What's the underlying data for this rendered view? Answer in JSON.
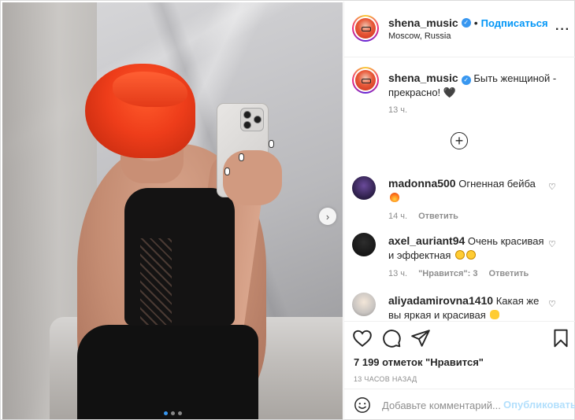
{
  "author": {
    "username": "shena_music",
    "verified_icon": "verified-badge-icon",
    "separator": "•",
    "follow_label": "Подписаться",
    "location": "Moscow, Russia",
    "more_icon": "more-options-icon",
    "more_symbol": "···"
  },
  "photo": {
    "next_icon": "chevron-right-icon",
    "next_symbol": "›",
    "slide_count": 3,
    "active_slide": 1
  },
  "caption": {
    "username": "shena_music",
    "text": "Быть женщиной - прекрасно! 🖤",
    "time": "13 ч."
  },
  "load_more": {
    "icon": "plus-circle-icon",
    "symbol": "+"
  },
  "comments": [
    {
      "username": "madonna500",
      "text": "Огненная бейба",
      "emoji": "fire-emoji",
      "time": "14 ч.",
      "likes_label": "",
      "reply_label": "Ответить"
    },
    {
      "username": "axel_auriant94",
      "text": "Очень красивая и эффектная",
      "emoji": "smile-emoji",
      "time": "13 ч.",
      "likes_label": "\"Нравится\": 3",
      "reply_label": "Ответить"
    },
    {
      "username": "aliyadamirovna1410",
      "text": "Какая же вы яркая и красивая",
      "emoji": "clap-emoji",
      "time": "",
      "likes_label": "",
      "reply_label": ""
    }
  ],
  "comment_like_symbol": "♡",
  "actions": {
    "like_icon": "heart-icon",
    "comment_icon": "comment-icon",
    "share_icon": "share-icon",
    "save_icon": "bookmark-icon",
    "likes_text": "7 199 отметок \"Нравится\"",
    "timestamp": "13 ЧАСОВ НАЗАД"
  },
  "add_comment": {
    "emoji_icon": "smiley-icon",
    "placeholder": "Добавьте комментарий...",
    "value": "",
    "publish_label": "Опубликовать"
  },
  "colors": {
    "accent": "#0095f6",
    "publish_disabled": "#b2dffc",
    "muted": "#8e8e8e",
    "text": "#262626",
    "carousel_active": "#3897f0"
  }
}
